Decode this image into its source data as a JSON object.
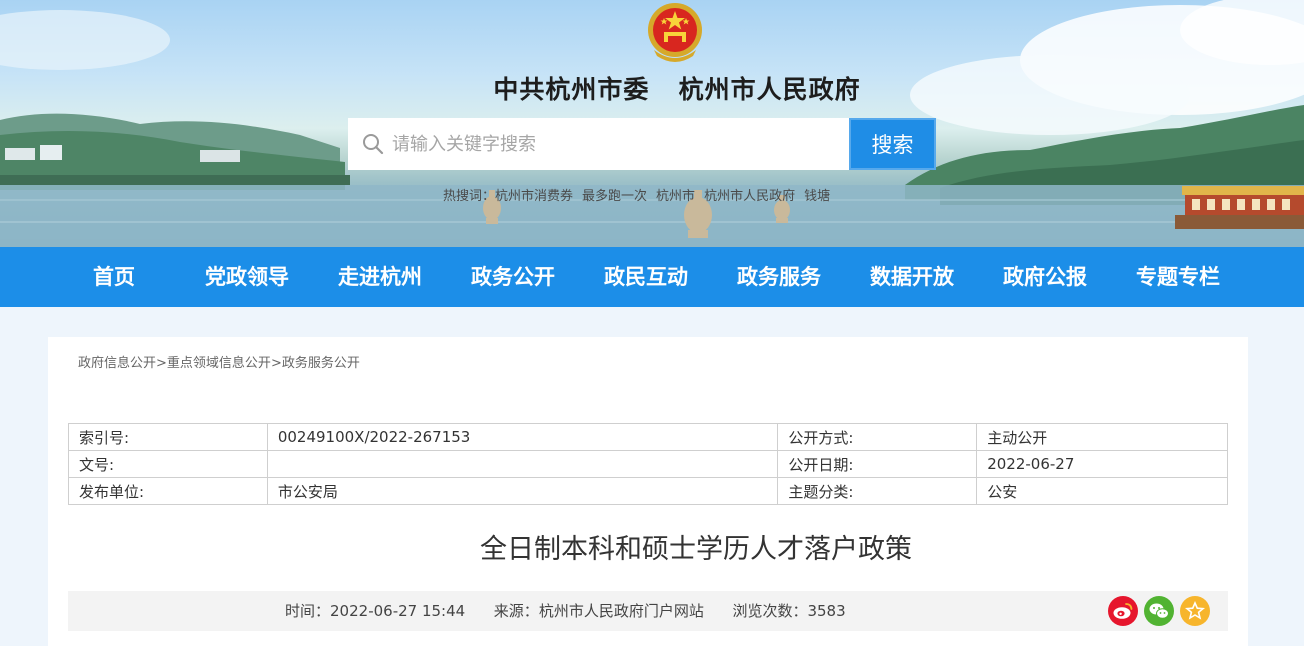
{
  "header": {
    "title_part1": "中共杭州市委",
    "title_part2": "杭州市人民政府",
    "search": {
      "placeholder": "请输入关键字搜索",
      "value": "",
      "button_label": "搜索"
    },
    "hot_words": [
      "热搜词：",
      "杭州市消费券",
      "最多跑一次",
      "杭州市",
      "杭州市人民政府",
      "钱塘"
    ]
  },
  "nav": {
    "items": [
      "首页",
      "党政领导",
      "走进杭州",
      "政务公开",
      "政民互动",
      "政务服务",
      "数据开放",
      "政府公报",
      "专题专栏"
    ]
  },
  "breadcrumb": {
    "items": [
      "政府信息公开",
      "重点领域信息公开",
      "政务服务公开"
    ],
    "separator": ">"
  },
  "meta_table": {
    "rows": [
      [
        "索引号:",
        "00249100X/2022-267153",
        "公开方式:",
        "主动公开"
      ],
      [
        "文号:",
        "",
        "公开日期:",
        "2022-06-27"
      ],
      [
        "发布单位:",
        "市公安局",
        "主题分类:",
        "公安"
      ]
    ]
  },
  "article": {
    "title": "全日制本科和硕士学历人才落户政策",
    "time_label": "时间：",
    "time": "2022-06-27 15:44",
    "source_label": "来源：",
    "source": "杭州市人民政府门户网站",
    "views_label": "浏览次数：",
    "views": "3583"
  },
  "share": {
    "icons": [
      "weibo-icon",
      "wechat-icon",
      "favorite-star-icon"
    ],
    "colors": {
      "weibo": "#e6162d",
      "wechat": "#51b332",
      "favorite": "#f7b52c"
    }
  },
  "colors": {
    "nav_bg": "#1c8ee8",
    "search_button": "#1f8de6",
    "page_bg": "#eef5fc"
  }
}
